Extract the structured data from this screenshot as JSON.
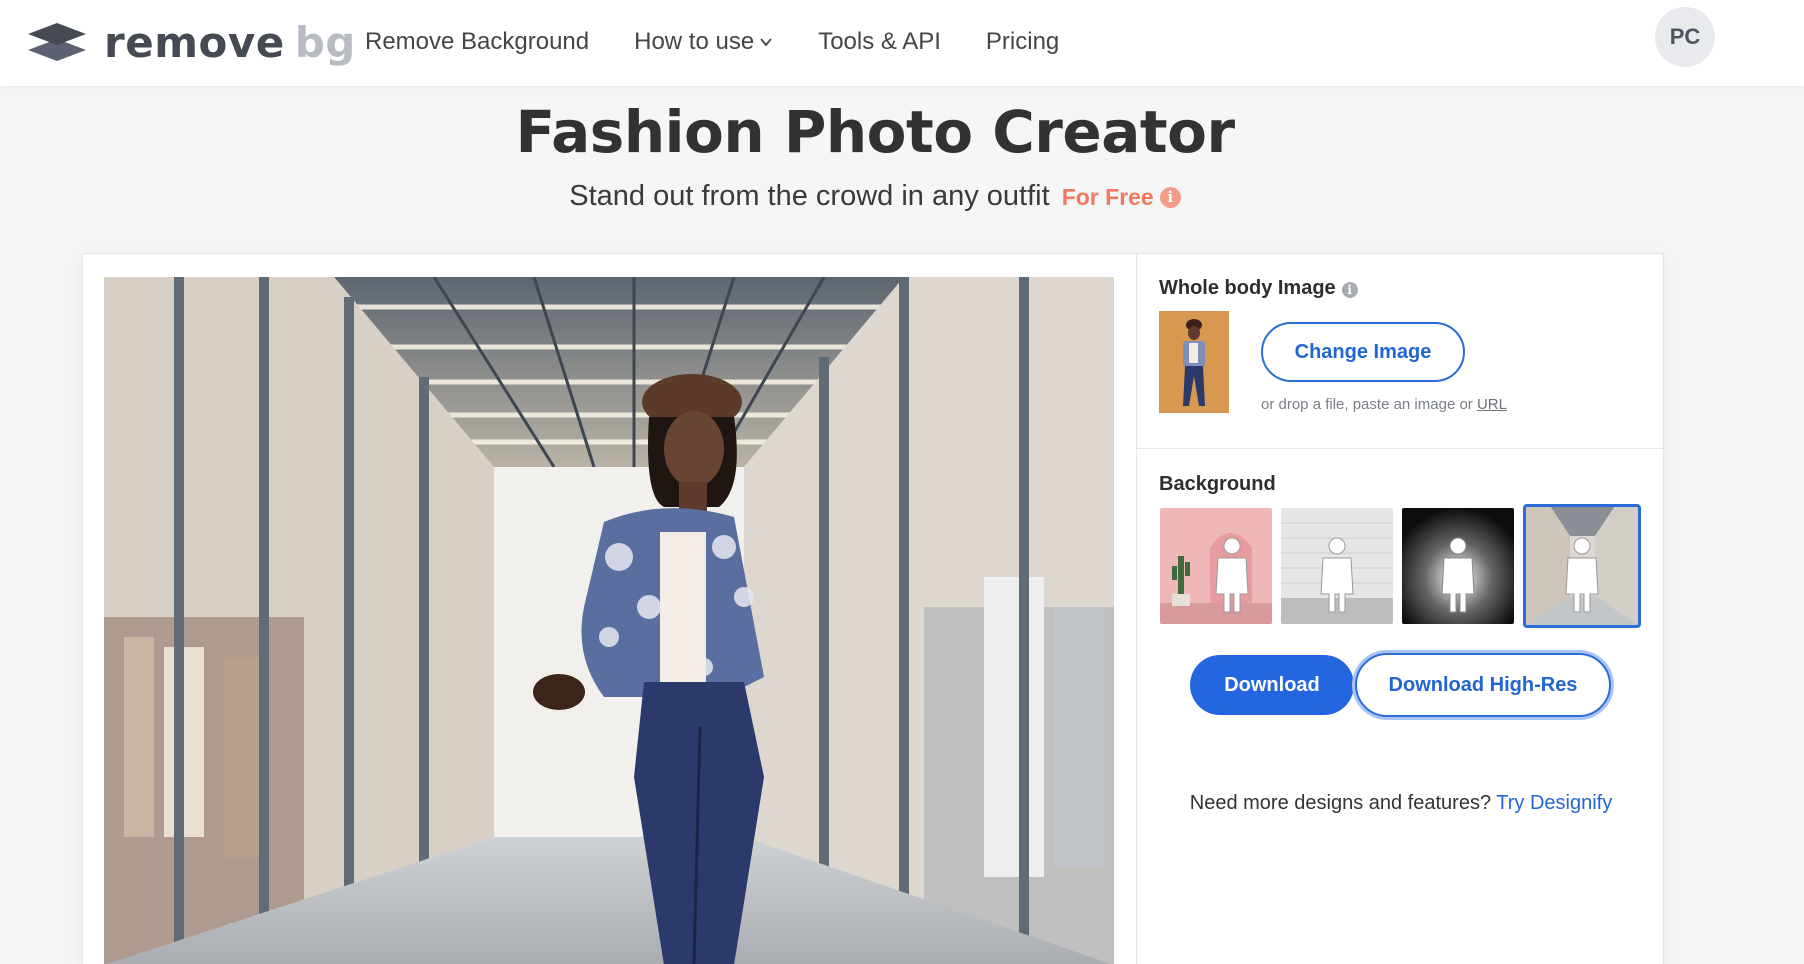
{
  "header": {
    "logo_word1": "remove",
    "logo_word2": "bg",
    "nav": [
      "Remove Background",
      "How to use",
      "Tools & API",
      "Pricing"
    ],
    "avatar_initials": "PC"
  },
  "hero": {
    "title": "Fashion Photo Creator",
    "subtitle": "Stand out from the crowd in any outfit",
    "free_label": "For Free",
    "info_glyph": "i"
  },
  "editor": {
    "whole_body_label": "Whole body Image",
    "change_image_label": "Change Image",
    "drop_hint": "or drop a file, paste an image or",
    "url_link": "URL",
    "background_label": "Background",
    "background_options": [
      "pink-arch-cactus",
      "white-brick-wall",
      "dark-studio-spotlight",
      "shopping-arcade"
    ],
    "selected_background": "shopping-arcade",
    "download_label": "Download",
    "download_hr_label": "Download High-Res",
    "more_text": "Need more designs and features?",
    "more_link": "Try Designify"
  },
  "colors": {
    "accent_blue": "#2466e0",
    "free_coral": "#f2795f"
  }
}
